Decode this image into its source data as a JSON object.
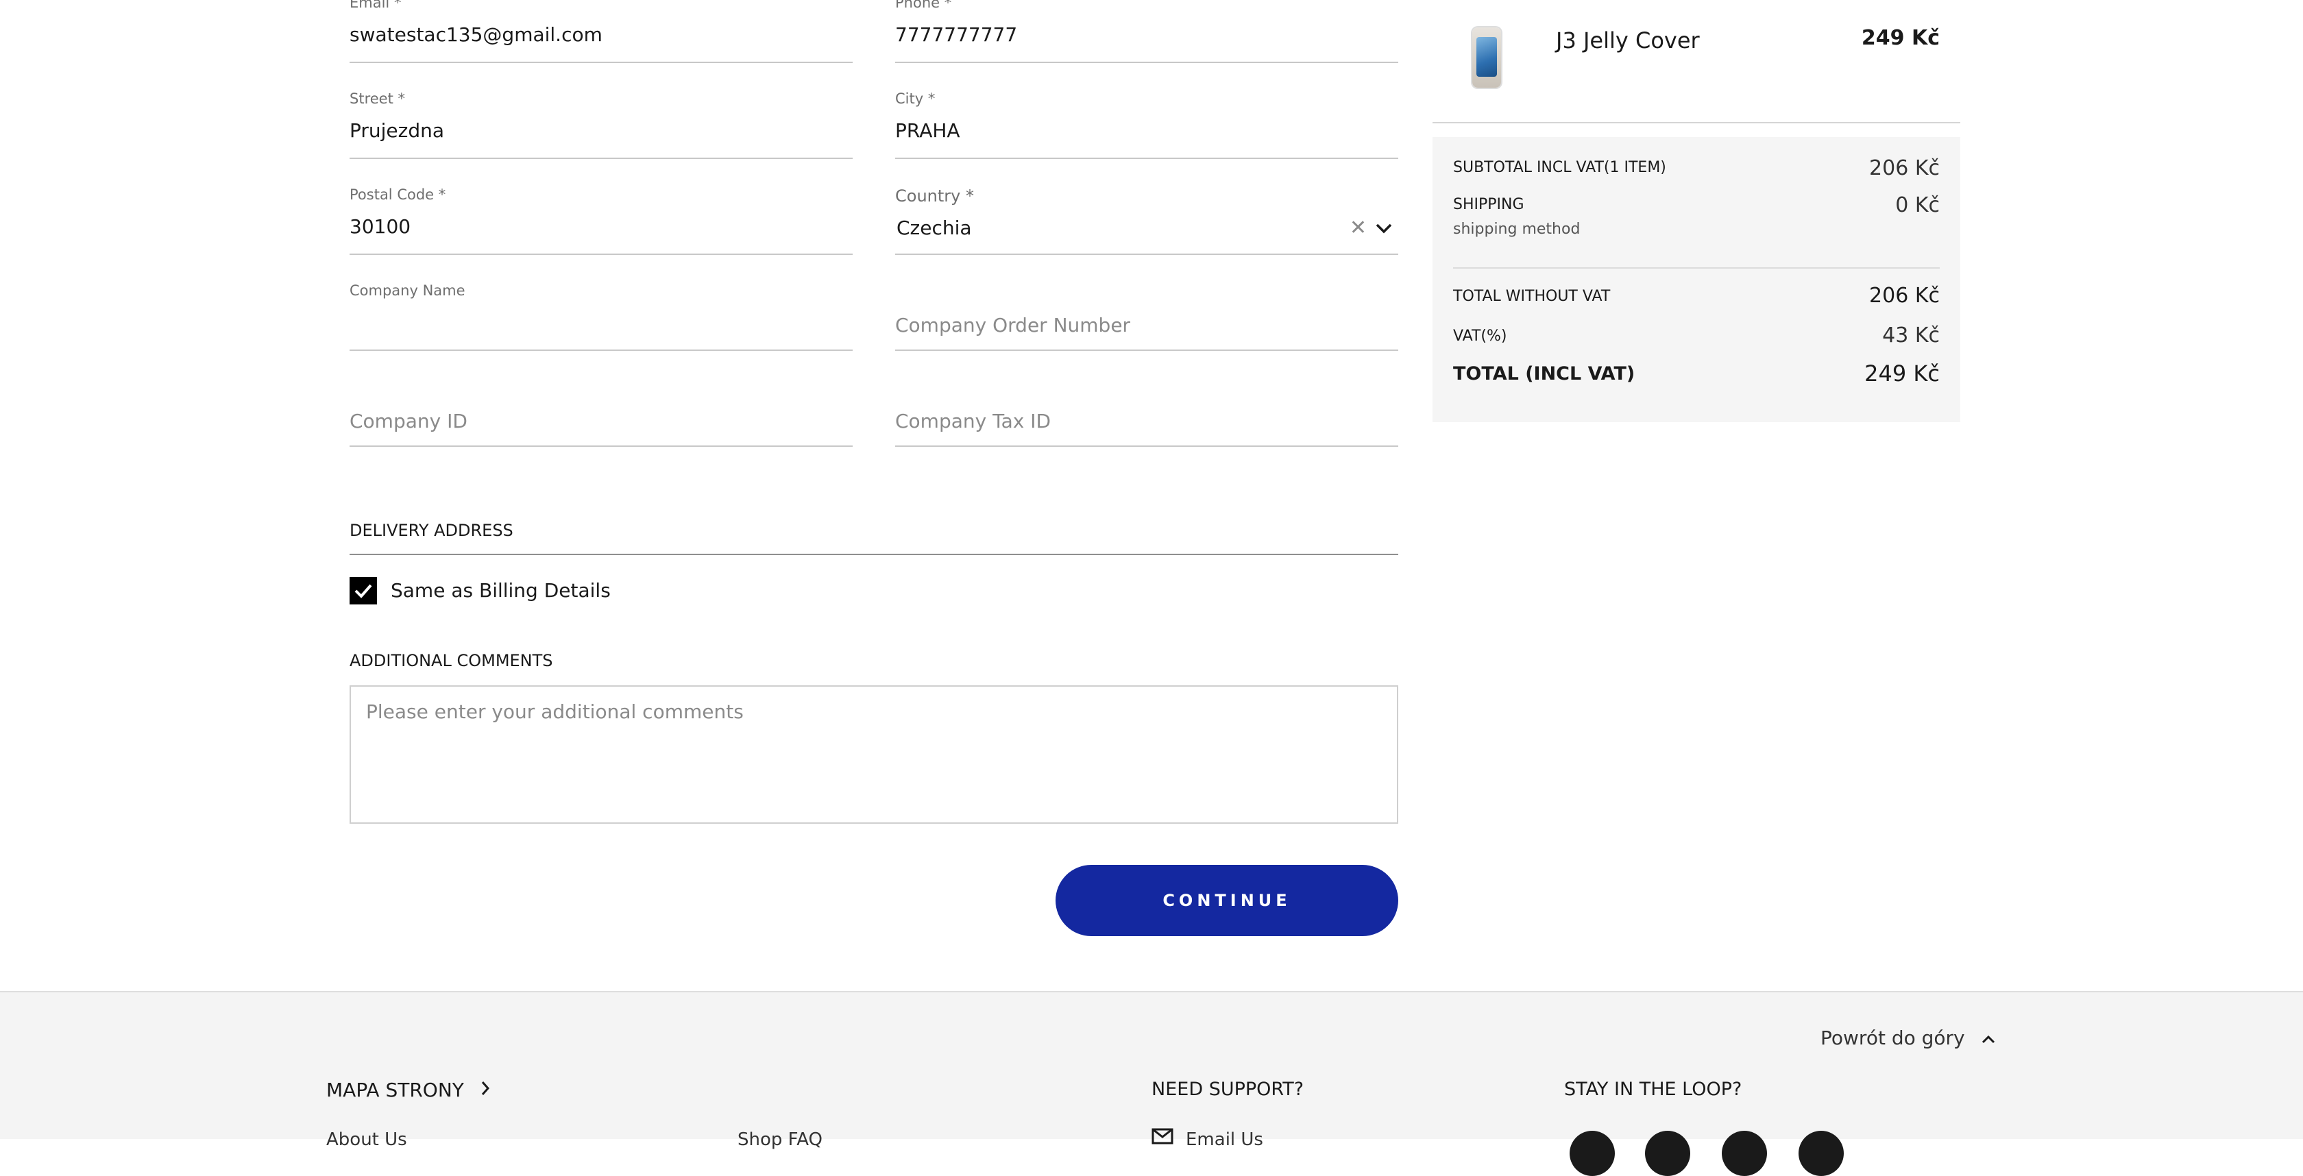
{
  "billing": {
    "email": {
      "label": "Email *",
      "value": "swatestac135@gmail.com"
    },
    "phone": {
      "label": "Phone *",
      "value": "7777777777"
    },
    "street": {
      "label": "Street *",
      "value": "Prujezdna"
    },
    "city": {
      "label": "City *",
      "value": "PRAHA"
    },
    "postal": {
      "label": "Postal Code *",
      "value": "30100"
    },
    "country": {
      "label": "Country *",
      "value": "Czechia"
    },
    "company_name": {
      "label": "Company Name",
      "value": ""
    },
    "company_order": {
      "placeholder": "Company Order Number"
    },
    "company_id": {
      "placeholder": "Company ID"
    },
    "company_tax": {
      "placeholder": "Company Tax ID"
    }
  },
  "delivery": {
    "title": "DELIVERY ADDRESS",
    "same_as_billing_label": "Same as Billing Details",
    "same_as_billing_checked": true
  },
  "comments": {
    "title": "ADDITIONAL COMMENTS",
    "placeholder": "Please enter your additional comments"
  },
  "continue_label": "CONTINUE",
  "summary": {
    "product_name": "J3 Jelly Cover",
    "product_price": "249 Kč",
    "subtotal_label": "SUBTOTAL INCL VAT(1 ITEM)",
    "subtotal_value": "206 Kč",
    "shipping_label": "SHIPPING",
    "shipping_sub": "shipping method",
    "shipping_value": "0 Kč",
    "total_wo_vat_label": "TOTAL WITHOUT VAT",
    "total_wo_vat_value": "206 Kč",
    "vat_label": "VAT(%)",
    "vat_value": "43 Kč",
    "total_label": "TOTAL (INCL VAT)",
    "total_value": "249 Kč"
  },
  "footer": {
    "back_to_top": "Powrót do góry",
    "sitemap": "MAPA STRONY",
    "need_support": "NEED SUPPORT?",
    "stay_in_loop": "STAY IN THE LOOP?",
    "link_about": "About Us",
    "link_faq": "Shop FAQ",
    "link_email": "Email Us"
  },
  "colors": {
    "accent": "#1428a0",
    "summary_bg": "#f5f5f5",
    "footer_bg": "#f4f4f4"
  }
}
